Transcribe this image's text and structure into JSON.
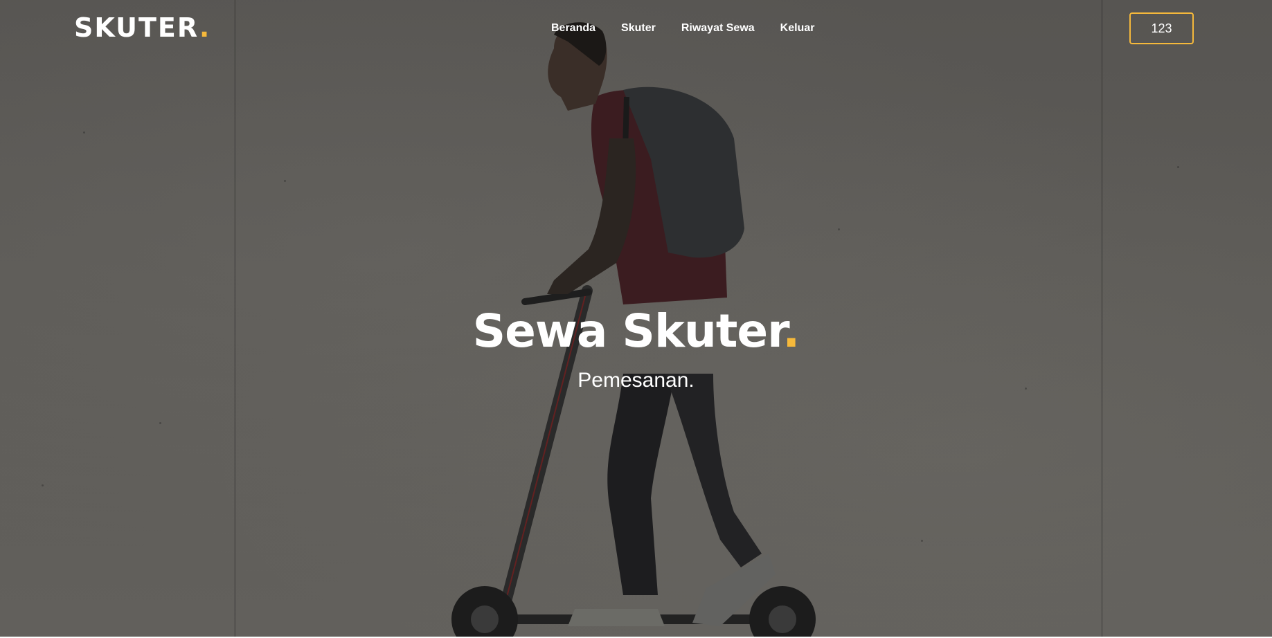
{
  "brand": {
    "name": "SKUTER",
    "dot": "."
  },
  "nav": {
    "items": [
      {
        "label": "Beranda"
      },
      {
        "label": "Skuter"
      },
      {
        "label": "Riwayat Sewa"
      },
      {
        "label": "Keluar"
      }
    ],
    "user_button": "123"
  },
  "hero": {
    "title": "Sewa Skuter",
    "title_dot": ".",
    "subtitle": "Pemesanan."
  },
  "colors": {
    "accent": "#f6b93b",
    "overlay": "#595754",
    "text": "#ffffff"
  }
}
